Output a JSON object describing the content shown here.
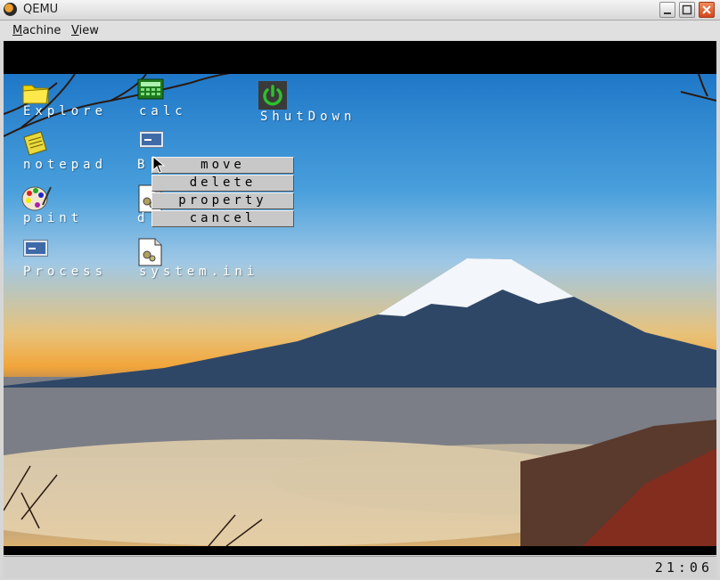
{
  "window": {
    "title": "QEMU"
  },
  "menubar": {
    "items": [
      {
        "label_first": "M",
        "label_rest": "achine"
      },
      {
        "label_first": "V",
        "label_rest": "iew"
      }
    ]
  },
  "desktop": {
    "icons": [
      {
        "label": "Explore",
        "icon": "folder-icon"
      },
      {
        "label": "calc",
        "icon": "calculator-icon"
      },
      {
        "label": "ShutDown",
        "icon": "power-icon"
      },
      {
        "label": "notepad",
        "icon": "notepad-icon"
      },
      {
        "label": "B",
        "icon": "window-icon"
      },
      {
        "label": "paint",
        "icon": "palette-icon"
      },
      {
        "label": "d",
        "icon": "config-file-icon"
      },
      {
        "label": "Process",
        "icon": "window-icon"
      },
      {
        "label": "system.ini",
        "icon": "config-file-icon"
      }
    ]
  },
  "context_menu": {
    "items": [
      "move",
      "delete",
      "property",
      "cancel"
    ]
  },
  "statusbar": {
    "clock": "21:06"
  },
  "colors": {
    "label": "#ffffff",
    "menu_bg": "#c8c8c8",
    "close_button": "#e05a2a",
    "power_green": "#2ec02e"
  }
}
